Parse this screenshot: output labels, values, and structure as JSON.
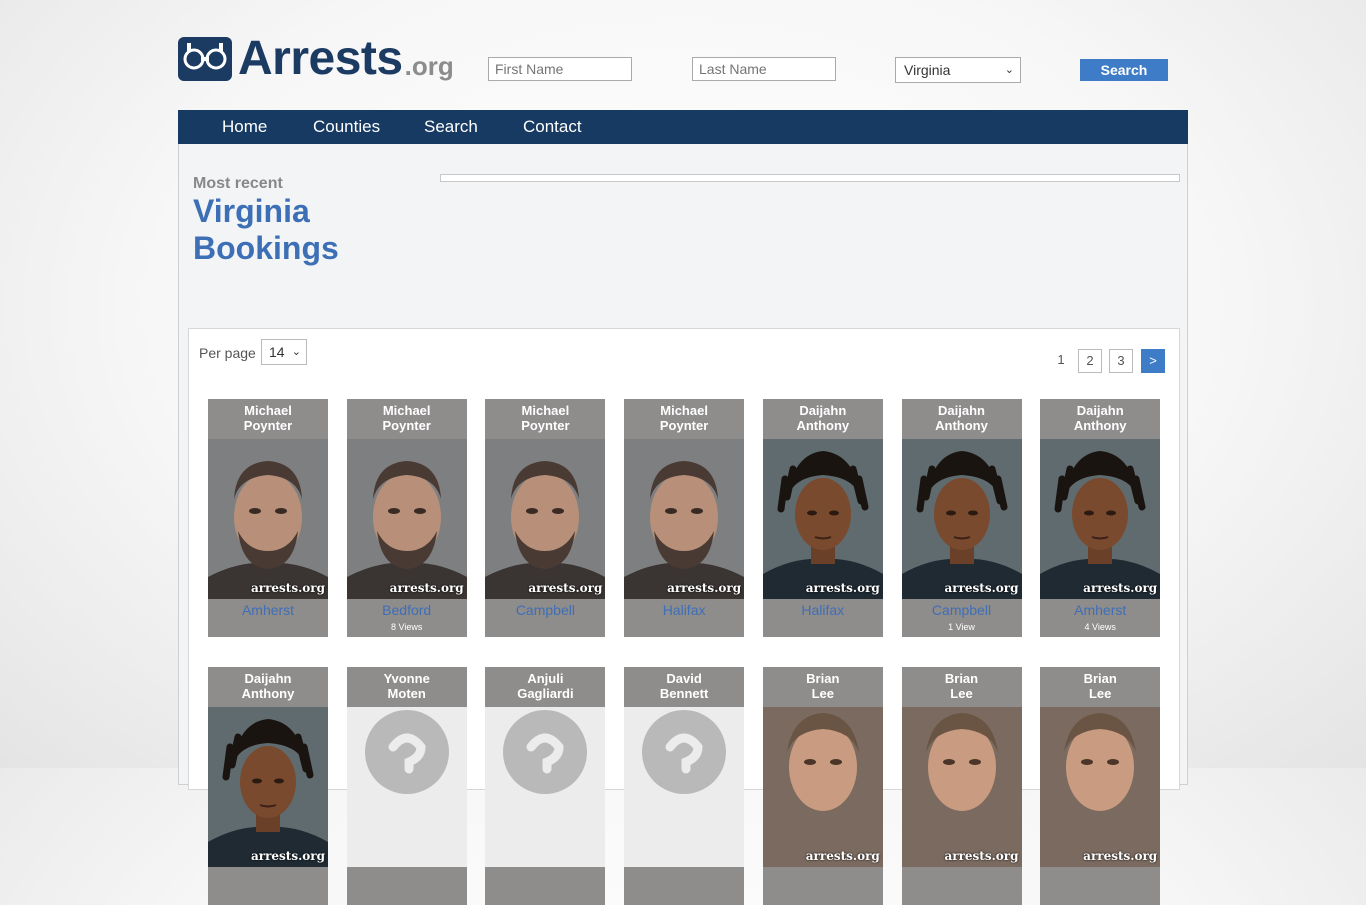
{
  "header": {
    "logo_main": "Arrests",
    "logo_tld": ".org",
    "first_name_placeholder": "First Name",
    "last_name_placeholder": "Last Name",
    "state_selected": "Virginia",
    "search_label": "Search"
  },
  "nav": [
    "Home",
    "Counties",
    "Search",
    "Contact"
  ],
  "page": {
    "subtitle": "Most recent",
    "title_line1": "Virginia",
    "title_line2": "Bookings"
  },
  "listing": {
    "per_page_label": "Per page",
    "per_page_value": "14",
    "pages": [
      "1",
      "2",
      "3"
    ],
    "next_label": ">",
    "watermark": "arrests.org",
    "cards": [
      {
        "first": "Michael",
        "last": "Poynter",
        "county": "Amherst",
        "views": "",
        "photo": "man-beard"
      },
      {
        "first": "Michael",
        "last": "Poynter",
        "county": "Bedford",
        "views": "8 Views",
        "photo": "man-beard"
      },
      {
        "first": "Michael",
        "last": "Poynter",
        "county": "Campbell",
        "views": "",
        "photo": "man-beard"
      },
      {
        "first": "Michael",
        "last": "Poynter",
        "county": "Halifax",
        "views": "",
        "photo": "man-beard"
      },
      {
        "first": "Daijahn",
        "last": "Anthony",
        "county": "Halifax",
        "views": "",
        "photo": "man-dreads"
      },
      {
        "first": "Daijahn",
        "last": "Anthony",
        "county": "Campbell",
        "views": "1 View",
        "photo": "man-dreads"
      },
      {
        "first": "Daijahn",
        "last": "Anthony",
        "county": "Amherst",
        "views": "4 Views",
        "photo": "man-dreads"
      },
      {
        "first": "Daijahn",
        "last": "Anthony",
        "county": "",
        "views": "",
        "photo": "man-dreads"
      },
      {
        "first": "Yvonne",
        "last": "Moten",
        "county": "",
        "views": "",
        "photo": "placeholder"
      },
      {
        "first": "Anjuli",
        "last": "Gagliardi",
        "county": "",
        "views": "",
        "photo": "placeholder"
      },
      {
        "first": "David",
        "last": "Bennett",
        "county": "",
        "views": "",
        "photo": "placeholder"
      },
      {
        "first": "Brian",
        "last": "Lee",
        "county": "",
        "views": "",
        "photo": "man-older"
      },
      {
        "first": "Brian",
        "last": "Lee",
        "county": "",
        "views": "",
        "photo": "man-older"
      },
      {
        "first": "Brian",
        "last": "Lee",
        "county": "",
        "views": "",
        "photo": "man-older"
      }
    ]
  }
}
